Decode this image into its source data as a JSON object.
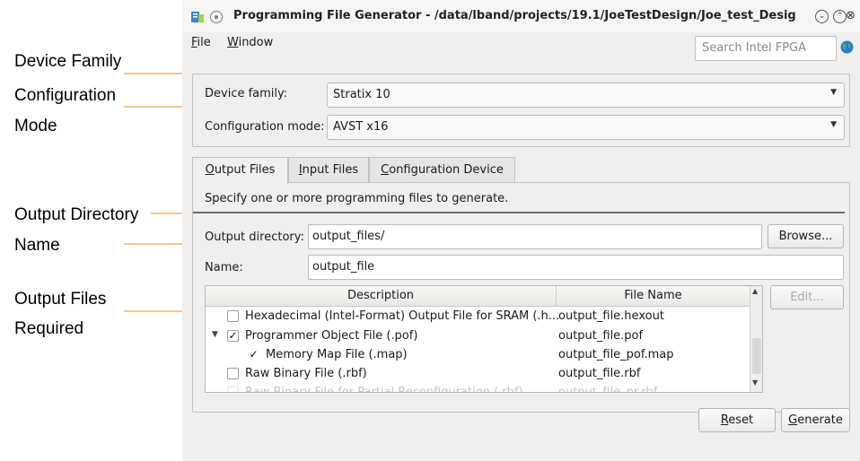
{
  "callouts": {
    "device_family": "Device Family",
    "config_line1": "Configuration",
    "config_line2": "Mode",
    "outdir_line1": "Output Directory",
    "outdir_line2": "Name",
    "outfiles_line1": "Output Files",
    "outfiles_line2": "Required"
  },
  "window": {
    "title": "Programming File Generator - /data/lband/projects/19.1/JoeTestDesign/Joe_test_Desig",
    "menu": {
      "file": "ile",
      "file_mnemonic": "F",
      "window": "indow",
      "window_mnemonic": "W"
    },
    "search_placeholder": "Search Intel FPGA"
  },
  "device": {
    "family_label": "Device family:",
    "family_value": "Stratix 10",
    "mode_label": "Configuration mode:",
    "mode_value": "AVST x16"
  },
  "tabs": [
    {
      "mnemonic": "O",
      "rest": "utput Files",
      "active": true
    },
    {
      "mnemonic": "I",
      "rest": "nput Files",
      "active": false
    },
    {
      "mnemonic": "C",
      "rest": "onfiguration Device",
      "active": false
    }
  ],
  "output": {
    "instruction": "Specify one or more programming files to generate.",
    "dir_label": "Output directory:",
    "dir_value": "output_files/",
    "browse_label": "Browse...",
    "name_label": "Name:",
    "name_value": "output_file",
    "edit_label": "Edit..."
  },
  "table": {
    "col_description": "Description",
    "col_filename": "File Name",
    "rows": [
      {
        "checked": false,
        "indent": 0,
        "description": "Hexadecimal (Intel-Format) Output File for SRAM (.h...",
        "filename": "output_file.hexout"
      },
      {
        "checked": true,
        "indent": 0,
        "expandable": true,
        "description": "Programmer Object File (.pof)",
        "filename": "output_file.pof"
      },
      {
        "checked": true,
        "indent": 1,
        "description": "Memory Map File (.map)",
        "filename": "output_file_pof.map"
      },
      {
        "checked": false,
        "indent": 0,
        "description": "Raw Binary File (.rbf)",
        "filename": "output_file.rbf"
      },
      {
        "checked": false,
        "indent": 0,
        "description": "Raw Binary File for Partial Reconfiguration (.rbf)",
        "filename": "output_file_pr.rbf"
      }
    ]
  },
  "buttons": {
    "reset": "eset",
    "reset_mnemonic": "R",
    "generate": "enerate",
    "generate_mnemonic": "G"
  },
  "colors": {
    "callout_line": "#f5a04a",
    "callout_arrow": "#f28c1e",
    "window_bg": "#f0efee"
  }
}
